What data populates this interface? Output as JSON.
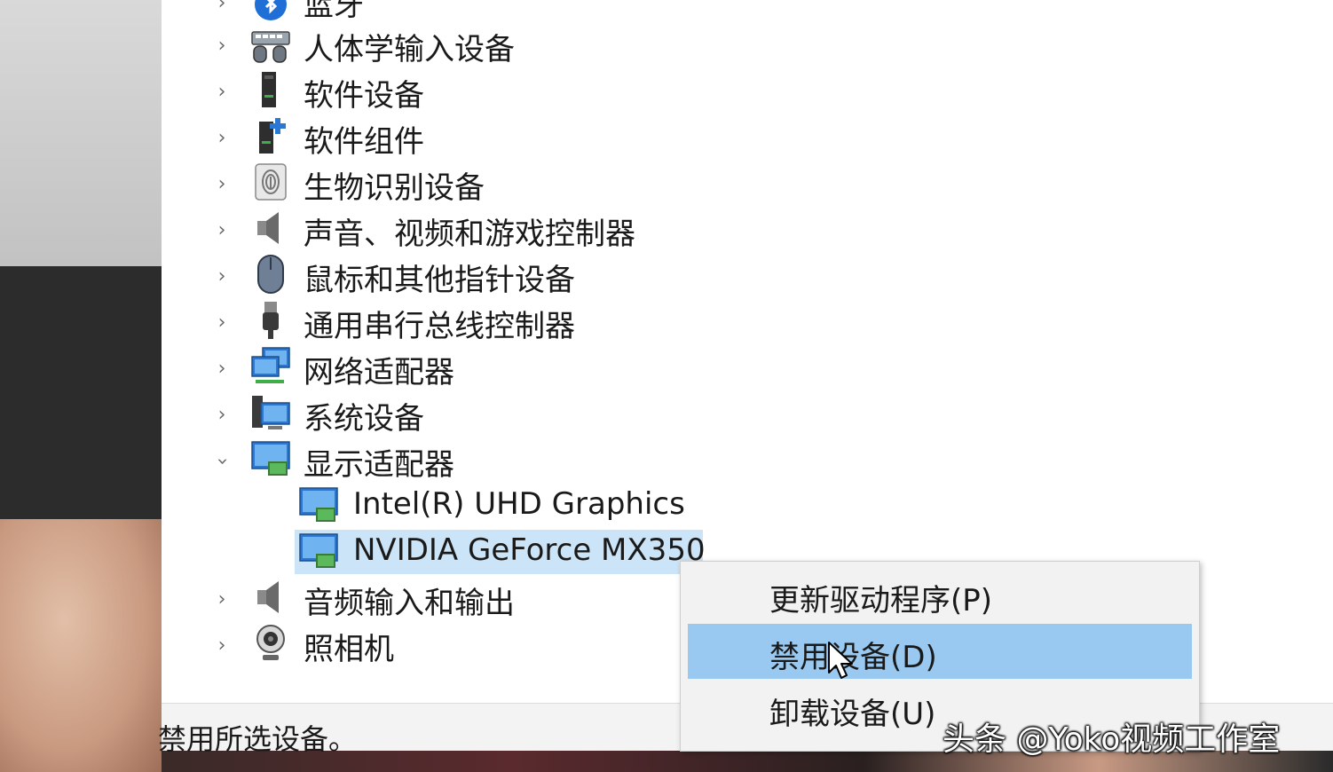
{
  "tree": {
    "items": [
      {
        "label": "蓝牙",
        "icon": "bluetooth-icon",
        "expanded": false
      },
      {
        "label": "人体学输入设备",
        "icon": "hid-icon",
        "expanded": false
      },
      {
        "label": "软件设备",
        "icon": "software-device-icon",
        "expanded": false
      },
      {
        "label": "软件组件",
        "icon": "software-component-icon",
        "expanded": false
      },
      {
        "label": "生物识别设备",
        "icon": "biometric-icon",
        "expanded": false
      },
      {
        "label": "声音、视频和游戏控制器",
        "icon": "speaker-icon",
        "expanded": false
      },
      {
        "label": "鼠标和其他指针设备",
        "icon": "mouse-icon",
        "expanded": false
      },
      {
        "label": "通用串行总线控制器",
        "icon": "usb-icon",
        "expanded": false
      },
      {
        "label": "网络适配器",
        "icon": "network-adapter-icon",
        "expanded": false
      },
      {
        "label": "系统设备",
        "icon": "system-device-icon",
        "expanded": false
      },
      {
        "label": "显示适配器",
        "icon": "display-adapter-icon",
        "expanded": true
      },
      {
        "label": "Intel(R) UHD Graphics",
        "icon": "display-adapter-icon",
        "child": true
      },
      {
        "label": "NVIDIA GeForce MX350",
        "icon": "display-adapter-icon",
        "child": true,
        "selected": true
      },
      {
        "label": "音频输入和输出",
        "icon": "speaker-icon",
        "expanded": false
      },
      {
        "label": "照相机",
        "icon": "camera-icon",
        "expanded": false
      }
    ]
  },
  "context_menu": {
    "items": [
      {
        "label": "更新驱动程序(P)",
        "highlighted": false
      },
      {
        "label": "禁用设备(D)",
        "highlighted": true
      },
      {
        "label": "卸载设备(U)",
        "highlighted": false
      }
    ]
  },
  "statusbar": {
    "text": "禁用所选设备。"
  },
  "watermark": {
    "text": "头条 @Yoko视频工作室"
  },
  "colors": {
    "selection": "#cce4f7",
    "menu_highlight": "#99c9f0",
    "window_bg": "#ffffff"
  }
}
